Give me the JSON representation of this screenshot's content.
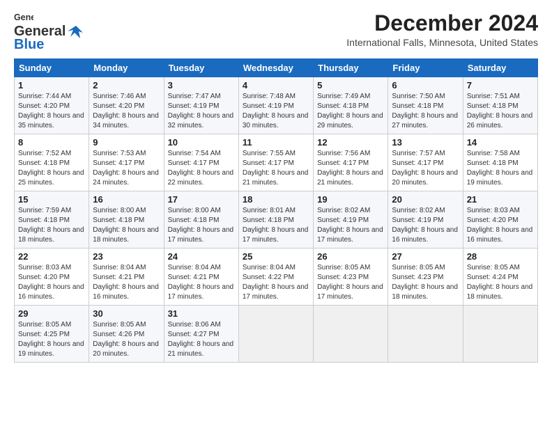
{
  "logo": {
    "line1": "General",
    "line2": "Blue"
  },
  "header": {
    "month": "December 2024",
    "location": "International Falls, Minnesota, United States"
  },
  "weekdays": [
    "Sunday",
    "Monday",
    "Tuesday",
    "Wednesday",
    "Thursday",
    "Friday",
    "Saturday"
  ],
  "weeks": [
    [
      {
        "day": "1",
        "sunrise": "Sunrise: 7:44 AM",
        "sunset": "Sunset: 4:20 PM",
        "daylight": "Daylight: 8 hours and 35 minutes."
      },
      {
        "day": "2",
        "sunrise": "Sunrise: 7:46 AM",
        "sunset": "Sunset: 4:20 PM",
        "daylight": "Daylight: 8 hours and 34 minutes."
      },
      {
        "day": "3",
        "sunrise": "Sunrise: 7:47 AM",
        "sunset": "Sunset: 4:19 PM",
        "daylight": "Daylight: 8 hours and 32 minutes."
      },
      {
        "day": "4",
        "sunrise": "Sunrise: 7:48 AM",
        "sunset": "Sunset: 4:19 PM",
        "daylight": "Daylight: 8 hours and 30 minutes."
      },
      {
        "day": "5",
        "sunrise": "Sunrise: 7:49 AM",
        "sunset": "Sunset: 4:18 PM",
        "daylight": "Daylight: 8 hours and 29 minutes."
      },
      {
        "day": "6",
        "sunrise": "Sunrise: 7:50 AM",
        "sunset": "Sunset: 4:18 PM",
        "daylight": "Daylight: 8 hours and 27 minutes."
      },
      {
        "day": "7",
        "sunrise": "Sunrise: 7:51 AM",
        "sunset": "Sunset: 4:18 PM",
        "daylight": "Daylight: 8 hours and 26 minutes."
      }
    ],
    [
      {
        "day": "8",
        "sunrise": "Sunrise: 7:52 AM",
        "sunset": "Sunset: 4:18 PM",
        "daylight": "Daylight: 8 hours and 25 minutes."
      },
      {
        "day": "9",
        "sunrise": "Sunrise: 7:53 AM",
        "sunset": "Sunset: 4:17 PM",
        "daylight": "Daylight: 8 hours and 24 minutes."
      },
      {
        "day": "10",
        "sunrise": "Sunrise: 7:54 AM",
        "sunset": "Sunset: 4:17 PM",
        "daylight": "Daylight: 8 hours and 22 minutes."
      },
      {
        "day": "11",
        "sunrise": "Sunrise: 7:55 AM",
        "sunset": "Sunset: 4:17 PM",
        "daylight": "Daylight: 8 hours and 21 minutes."
      },
      {
        "day": "12",
        "sunrise": "Sunrise: 7:56 AM",
        "sunset": "Sunset: 4:17 PM",
        "daylight": "Daylight: 8 hours and 21 minutes."
      },
      {
        "day": "13",
        "sunrise": "Sunrise: 7:57 AM",
        "sunset": "Sunset: 4:17 PM",
        "daylight": "Daylight: 8 hours and 20 minutes."
      },
      {
        "day": "14",
        "sunrise": "Sunrise: 7:58 AM",
        "sunset": "Sunset: 4:18 PM",
        "daylight": "Daylight: 8 hours and 19 minutes."
      }
    ],
    [
      {
        "day": "15",
        "sunrise": "Sunrise: 7:59 AM",
        "sunset": "Sunset: 4:18 PM",
        "daylight": "Daylight: 8 hours and 18 minutes."
      },
      {
        "day": "16",
        "sunrise": "Sunrise: 8:00 AM",
        "sunset": "Sunset: 4:18 PM",
        "daylight": "Daylight: 8 hours and 18 minutes."
      },
      {
        "day": "17",
        "sunrise": "Sunrise: 8:00 AM",
        "sunset": "Sunset: 4:18 PM",
        "daylight": "Daylight: 8 hours and 17 minutes."
      },
      {
        "day": "18",
        "sunrise": "Sunrise: 8:01 AM",
        "sunset": "Sunset: 4:18 PM",
        "daylight": "Daylight: 8 hours and 17 minutes."
      },
      {
        "day": "19",
        "sunrise": "Sunrise: 8:02 AM",
        "sunset": "Sunset: 4:19 PM",
        "daylight": "Daylight: 8 hours and 17 minutes."
      },
      {
        "day": "20",
        "sunrise": "Sunrise: 8:02 AM",
        "sunset": "Sunset: 4:19 PM",
        "daylight": "Daylight: 8 hours and 16 minutes."
      },
      {
        "day": "21",
        "sunrise": "Sunrise: 8:03 AM",
        "sunset": "Sunset: 4:20 PM",
        "daylight": "Daylight: 8 hours and 16 minutes."
      }
    ],
    [
      {
        "day": "22",
        "sunrise": "Sunrise: 8:03 AM",
        "sunset": "Sunset: 4:20 PM",
        "daylight": "Daylight: 8 hours and 16 minutes."
      },
      {
        "day": "23",
        "sunrise": "Sunrise: 8:04 AM",
        "sunset": "Sunset: 4:21 PM",
        "daylight": "Daylight: 8 hours and 16 minutes."
      },
      {
        "day": "24",
        "sunrise": "Sunrise: 8:04 AM",
        "sunset": "Sunset: 4:21 PM",
        "daylight": "Daylight: 8 hours and 17 minutes."
      },
      {
        "day": "25",
        "sunrise": "Sunrise: 8:04 AM",
        "sunset": "Sunset: 4:22 PM",
        "daylight": "Daylight: 8 hours and 17 minutes."
      },
      {
        "day": "26",
        "sunrise": "Sunrise: 8:05 AM",
        "sunset": "Sunset: 4:23 PM",
        "daylight": "Daylight: 8 hours and 17 minutes."
      },
      {
        "day": "27",
        "sunrise": "Sunrise: 8:05 AM",
        "sunset": "Sunset: 4:23 PM",
        "daylight": "Daylight: 8 hours and 18 minutes."
      },
      {
        "day": "28",
        "sunrise": "Sunrise: 8:05 AM",
        "sunset": "Sunset: 4:24 PM",
        "daylight": "Daylight: 8 hours and 18 minutes."
      }
    ],
    [
      {
        "day": "29",
        "sunrise": "Sunrise: 8:05 AM",
        "sunset": "Sunset: 4:25 PM",
        "daylight": "Daylight: 8 hours and 19 minutes."
      },
      {
        "day": "30",
        "sunrise": "Sunrise: 8:05 AM",
        "sunset": "Sunset: 4:26 PM",
        "daylight": "Daylight: 8 hours and 20 minutes."
      },
      {
        "day": "31",
        "sunrise": "Sunrise: 8:06 AM",
        "sunset": "Sunset: 4:27 PM",
        "daylight": "Daylight: 8 hours and 21 minutes."
      },
      null,
      null,
      null,
      null
    ]
  ]
}
